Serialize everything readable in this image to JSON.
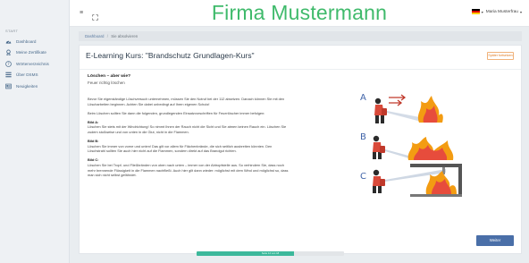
{
  "sidebar": {
    "section_label": "START",
    "items": [
      {
        "label": "Dashboard",
        "icon": "dashboard-icon"
      },
      {
        "label": "Meine Zertifikate",
        "icon": "certificate-icon"
      },
      {
        "label": "Wörterverzeichnis",
        "icon": "help-circle-icon"
      },
      {
        "label": "Über DSMS",
        "icon": "list-icon"
      },
      {
        "label": "Neuigkeiten",
        "icon": "news-icon"
      }
    ]
  },
  "header": {
    "brand": "Firma Mustermann",
    "user_name": "Maria Musterfrau",
    "caret": "▾",
    "menu_icon": "≡"
  },
  "breadcrumb": {
    "items": [
      "Dashboard",
      "Sie absolvieren"
    ],
    "separator": "/"
  },
  "course": {
    "title": "E-Learning Kurs: \"Brandschutz Grundlagen-Kurs\"",
    "exit_button": "Später fortsetzen"
  },
  "lesson": {
    "heading": "Löschen – aber wie?",
    "subheading": "Feuer richtig löschen",
    "intro": "Bevor Sie eigenständige Löschversuch unternehmen, müssen Sie den Notruf bei der 112 absetzen. Danach können Sie mit den Löscharbeiten beginnen. Achten Sie dabei unbedingt auf Ihren eigenen Schutz!",
    "rules_intro": "Beim Löschen sollten Sie dann die folgenden, grundlegenden Einsatzvorschriften für Feuerlöscher immer befolgen:",
    "sections": [
      {
        "label": "Bild A:",
        "text": "Löschen Sie stets mit der Windrichtung! So nimmt Ihnen der Rauch nicht die Sicht und Sie atmen keinen Rauch ein. Löschen Sie zudem stoßweise und von unten in die Glut, nicht in die Flammen."
      },
      {
        "label": "Bild B:",
        "text": "Löschen Sie immer von vorne und unten! Das gilt vor allem für Flächenbrände, die sich seitlich ausbreiten könnten. Den Löschstrahl sollten Sie auch hier nicht auf die Flammen, sondern direkt auf das Brandgut richten."
      },
      {
        "label": "Bild C:",
        "text": "Löschen Sie bei Tropf- und Fließbränden von oben nach unten – immer von der Abtropfstelle aus. So verhindern Sie, dass noch mehr brennende Flüssigkeit in die Flammen nachfließt. Auch hier gilt dann wieder: möglichst mit dem Wind und möglichst so, dass man sich nicht selbst gefährdet."
      }
    ],
    "figure_labels": [
      "A",
      "B",
      "C"
    ]
  },
  "footer": {
    "next_button": "Weiter",
    "progress_label": "Seite 12 von 18",
    "progress_fraction": 0.66
  },
  "colors": {
    "brand": "#3fba6b",
    "primary": "#4a6fa8",
    "progress": "#3cb89b",
    "warning": "#e07c24"
  }
}
